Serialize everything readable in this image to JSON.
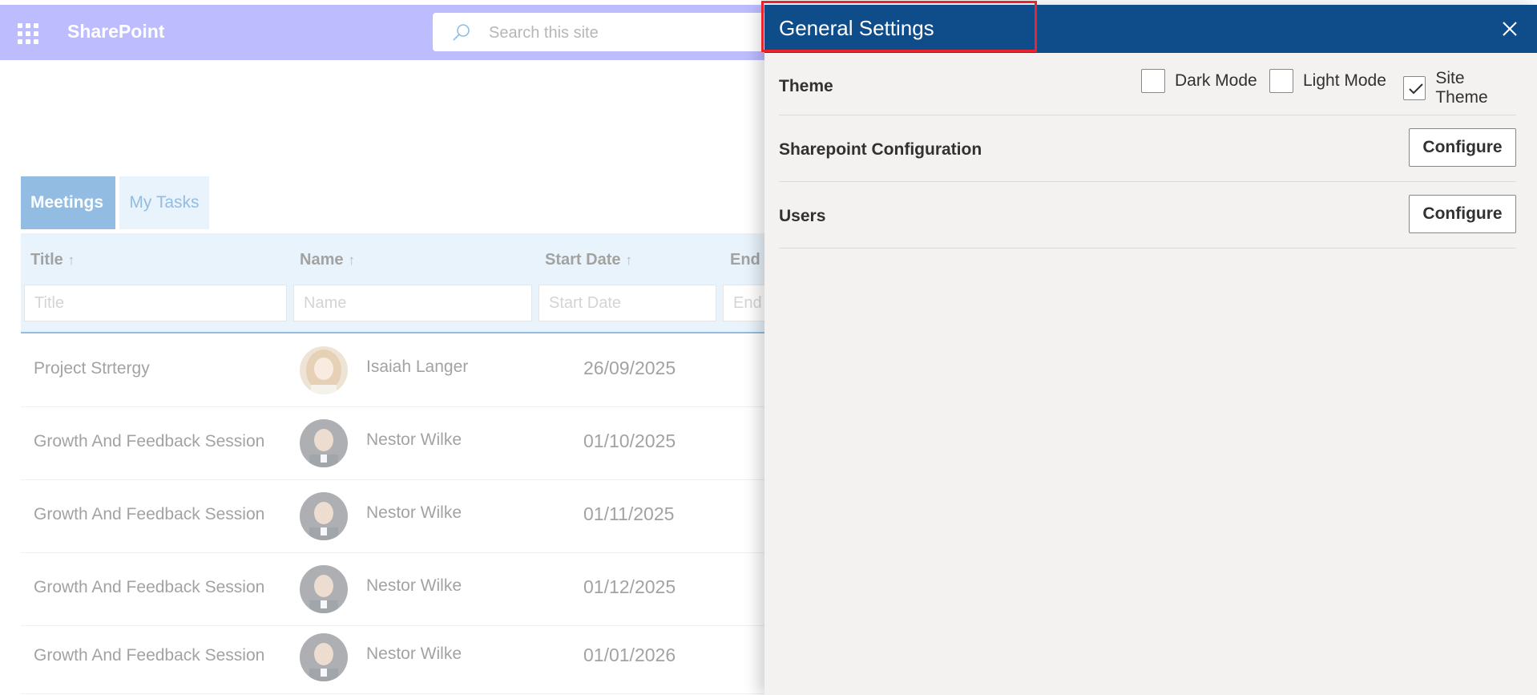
{
  "topbar": {
    "brand": "SharePoint",
    "search_placeholder": "Search this site"
  },
  "tabs": [
    {
      "label": "Meetings",
      "active": true
    },
    {
      "label": "My Tasks",
      "active": false
    }
  ],
  "grid": {
    "columns": [
      {
        "label": "Title",
        "sort": "↑"
      },
      {
        "label": "Name",
        "sort": "↑"
      },
      {
        "label": "Start Date",
        "sort": "↑"
      },
      {
        "label": "End",
        "sort": ""
      }
    ],
    "filters": [
      "Title",
      "Name",
      "Start Date",
      "End"
    ],
    "rows": [
      {
        "title": "Project Strtergy",
        "name": "Isaiah Langer",
        "start": "26/09/2025",
        "avatar": "female"
      },
      {
        "title": "Growth And Feedback Session",
        "name": "Nestor Wilke",
        "start": "01/10/2025",
        "avatar": "male"
      },
      {
        "title": "Growth And Feedback Session",
        "name": "Nestor Wilke",
        "start": "01/11/2025",
        "avatar": "male"
      },
      {
        "title": "Growth And Feedback Session",
        "name": "Nestor Wilke",
        "start": "01/12/2025",
        "avatar": "male"
      },
      {
        "title": "Growth And Feedback Session",
        "name": "Nestor Wilke",
        "start": "01/01/2026",
        "avatar": "male"
      }
    ]
  },
  "panel": {
    "title": "General Settings",
    "theme": {
      "label": "Theme",
      "options": [
        {
          "label": "Dark Mode",
          "checked": false
        },
        {
          "label": "Light Mode",
          "checked": false
        },
        {
          "label": "Site Theme",
          "checked": true
        }
      ]
    },
    "sharepoint_config": {
      "label": "Sharepoint Configuration",
      "button": "Configure"
    },
    "users": {
      "label": "Users",
      "button": "Configure"
    }
  },
  "colors": {
    "suite_bar": "#6b6bff",
    "panel_header": "#0f4c8a",
    "accent": "#0f6cbd",
    "highlight_box": "#e8242c"
  }
}
